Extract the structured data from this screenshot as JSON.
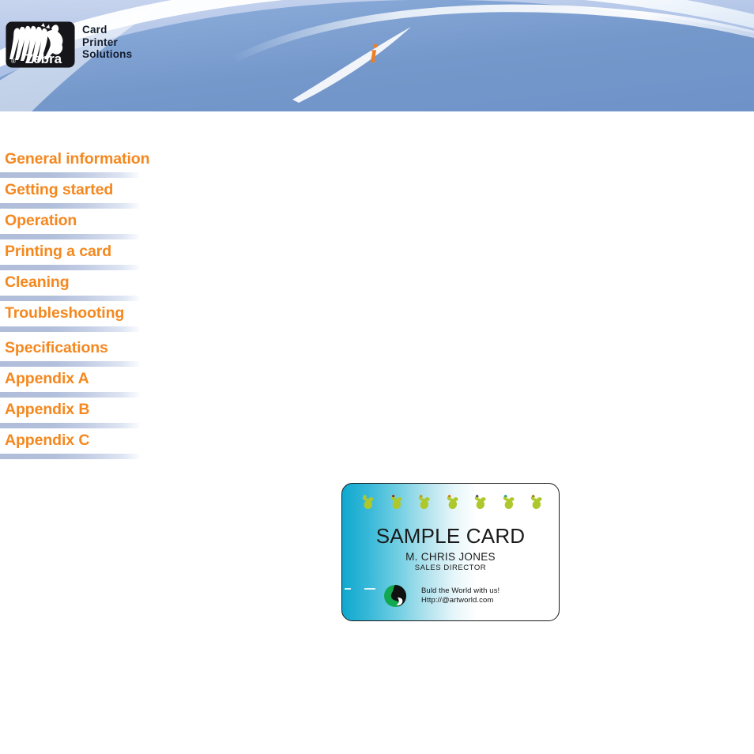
{
  "page": {
    "background_color": "#ffffff",
    "accent_orange": "#f4881f",
    "header_blue": "#7a9dd4"
  },
  "header": {
    "logo": {
      "icon_name": "zebra-logo",
      "wordmark": "Zebra",
      "registered_mark": "®"
    },
    "brand_lines": [
      "Card",
      "Printer",
      "Solutions"
    ],
    "info_glyph": "i"
  },
  "nav": {
    "items": [
      {
        "label": "General information"
      },
      {
        "label": "Getting started"
      },
      {
        "label": "Operation"
      },
      {
        "label": "Printing a card"
      },
      {
        "label": "Cleaning"
      },
      {
        "label": "Troubleshooting"
      },
      {
        "label": "Specifications"
      },
      {
        "label": "Appendix A"
      },
      {
        "label": "Appendix B"
      },
      {
        "label": "Appendix C"
      }
    ]
  },
  "sample_card": {
    "title": "SAMPLE CARD",
    "name": "M. CHRIS JONES",
    "role": "SALES DIRECTOR",
    "tagline": "Buld the World with us!",
    "url": "Http://@artworld.com",
    "logo_icon_name": "artworld-logo",
    "icon_row_name": "bird-icon",
    "icon_colors": [
      "#aec82c",
      "#8d1f1f",
      "#cf8b1c",
      "#e8691a",
      "#3b3bb0",
      "#1397c4",
      "#b5661f"
    ]
  }
}
